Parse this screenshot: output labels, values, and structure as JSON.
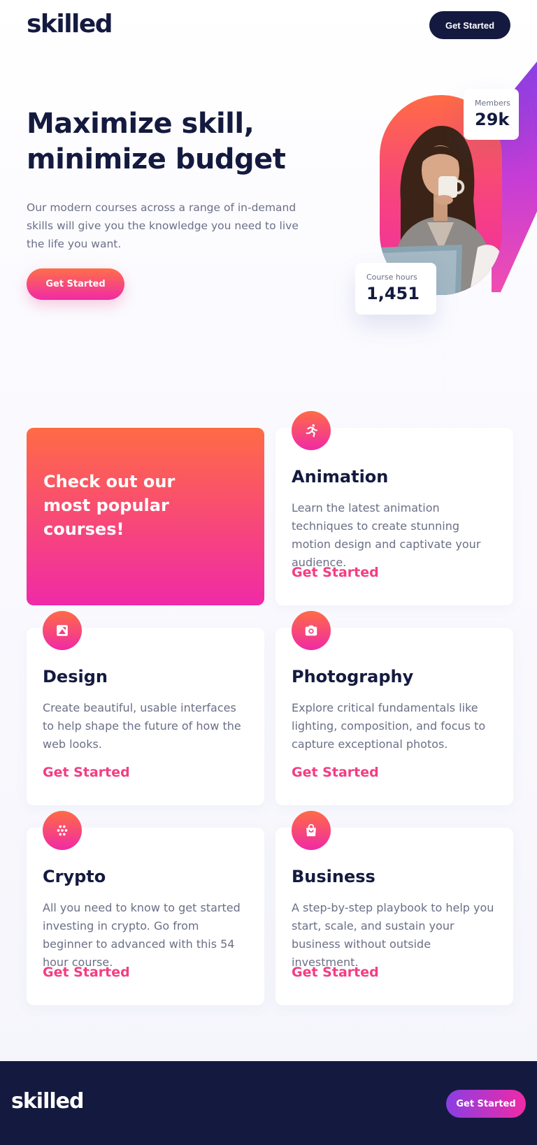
{
  "header": {
    "logo": "skilled",
    "cta_label": "Get Started"
  },
  "hero": {
    "title": "Maximize skill, minimize budget",
    "text": "Our modern courses across a range of in-demand skills will give you the knowledge you need to live the life you want.",
    "cta_label": "Get Started",
    "stats": {
      "members_label": "Members",
      "members_value": "29k",
      "hours_label": "Course hours",
      "hours_value": "1,451"
    }
  },
  "courses": {
    "promo_title": "Check out our most popular courses!",
    "items": [
      {
        "title": "Animation",
        "text": "Learn the latest animation techniques to create stunning motion design and captivate your audience.",
        "link": "Get Started",
        "icon": "running-person-icon"
      },
      {
        "title": "Design",
        "text": "Create beautiful, usable interfaces to help shape the future of how the web looks.",
        "link": "Get Started",
        "icon": "design-icon"
      },
      {
        "title": "Photography",
        "text": "Explore critical fundamentals like lighting, composition, and focus to capture exceptional photos.",
        "link": "Get Started",
        "icon": "camera-icon"
      },
      {
        "title": "Crypto",
        "text": "All you need to know to get started investing in crypto. Go from beginner to advanced with this 54 hour course.",
        "link": "Get Started",
        "icon": "crypto-icon"
      },
      {
        "title": "Business",
        "text": "A step-by-step playbook to help you start, scale, and sustain your business without outside investment.",
        "link": "Get Started",
        "icon": "shopping-bag-icon"
      }
    ]
  },
  "footer": {
    "logo": "skilled",
    "cta_label": "Get Started"
  },
  "colors": {
    "navy": "#141a3f",
    "accent_pink": "#f43d82",
    "gradient_start": "#ff6b45",
    "gradient_end": "#f02aa6",
    "purple": "#8a3ee3",
    "body_text": "#6b6f86"
  }
}
